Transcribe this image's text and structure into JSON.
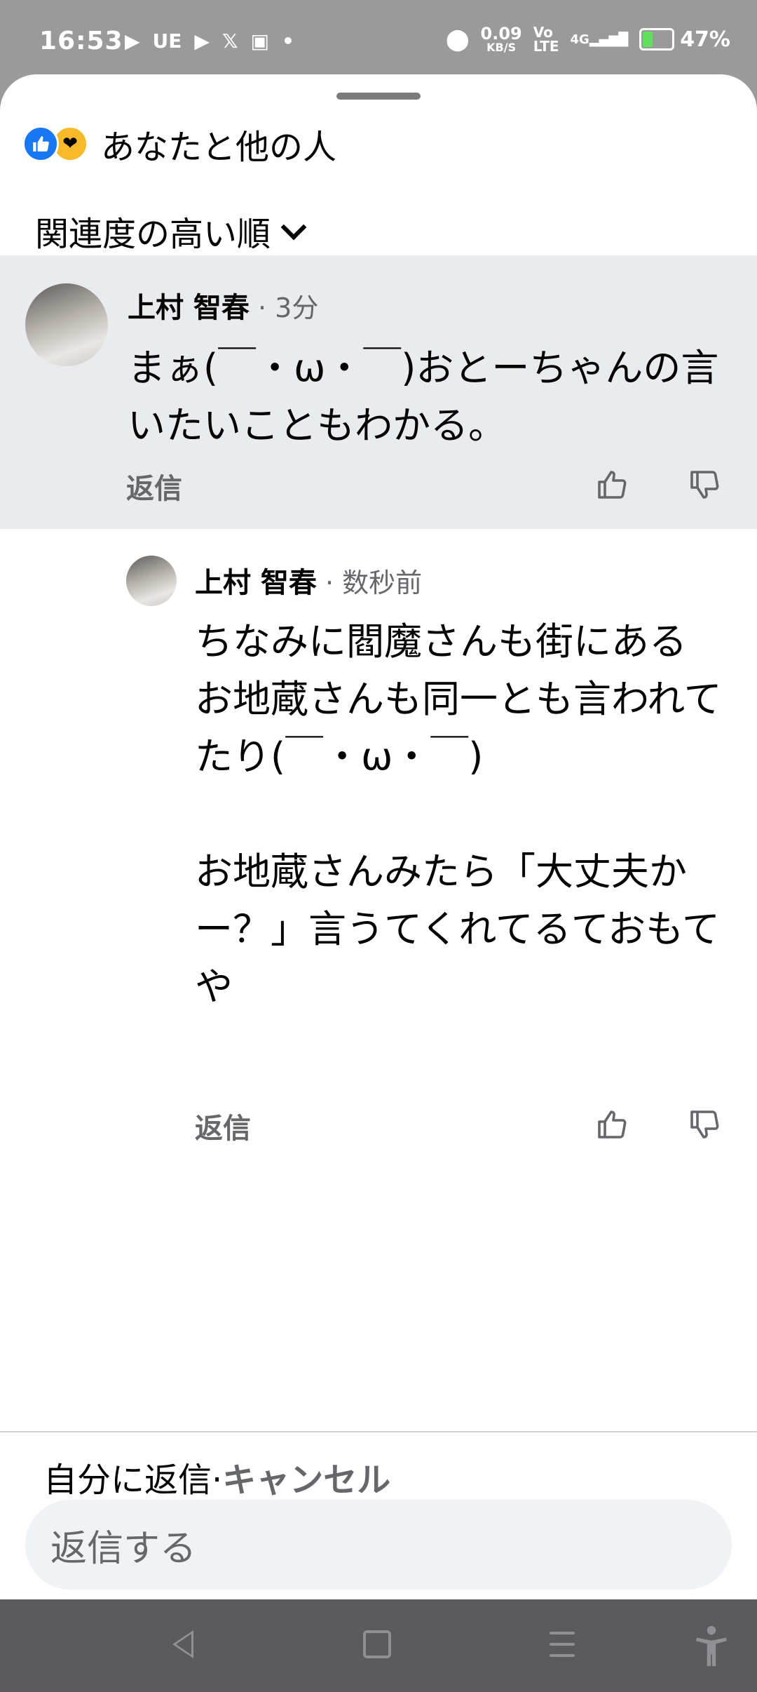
{
  "status": {
    "time": "16:53",
    "left_icons": [
      "UE"
    ],
    "net_speed": "0.09",
    "net_unit": "KB/S",
    "volte_top": "Vo",
    "volte_bottom": "LTE",
    "signal": "4G",
    "battery": "47%"
  },
  "header": {
    "reactions_label": "あなたと他の人",
    "sort_label": "関連度の高い順"
  },
  "comments": [
    {
      "author": "上村 智春",
      "time": " · 3分",
      "text": "まぁ(￣・ω・￣)おとーちゃんの言いたいこともわかる。",
      "reply_label": "返信"
    },
    {
      "author": "上村 智春",
      "time": " · 数秒前",
      "text": "ちなみに閻魔さんも街にある\nお地蔵さんも同一とも言われて\nたり(￣・ω・￣)\n\nお地蔵さんみたら「大丈夫か\nー？」言うてくれてるておもて\nや",
      "reply_label": "返信"
    }
  ],
  "reply_bar": {
    "replying_to": "自分に返信",
    "separator": "·",
    "cancel": "キャンセル",
    "placeholder": "返信する"
  }
}
